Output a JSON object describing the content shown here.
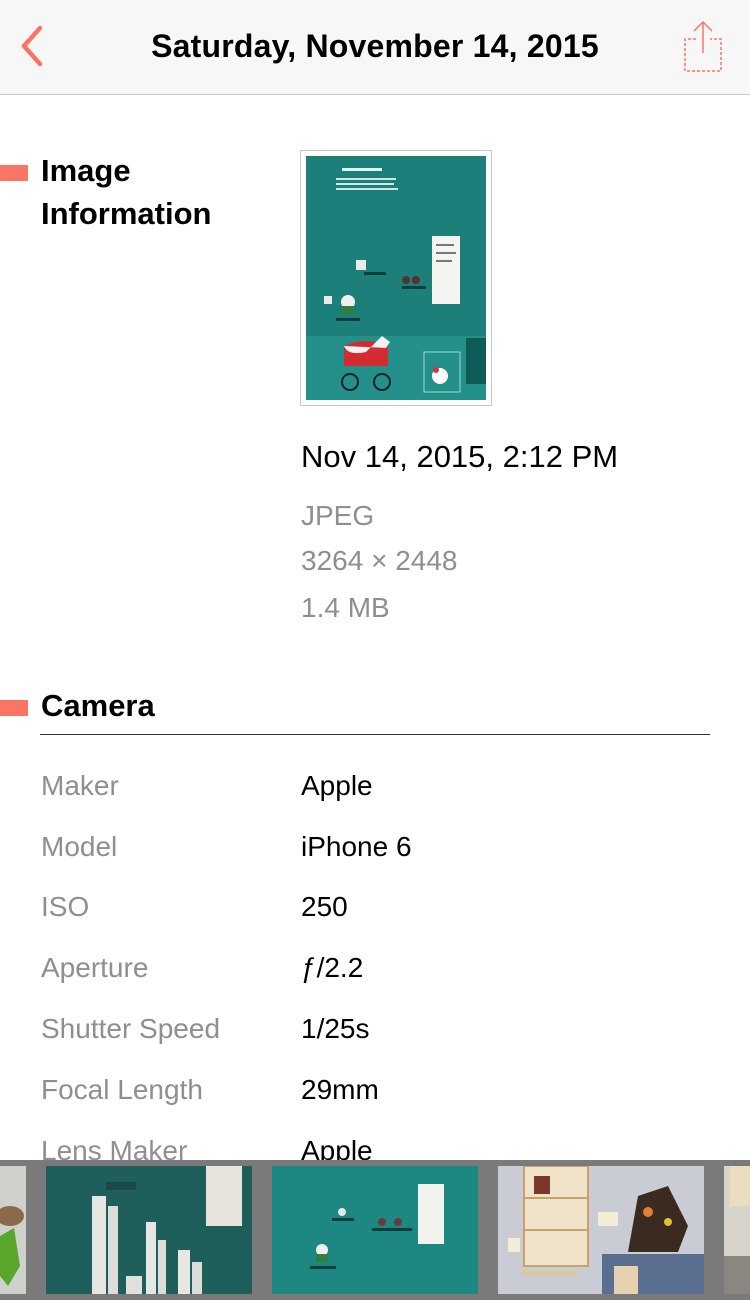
{
  "navbar": {
    "title": "Saturday, November 14, 2015",
    "back_icon": "chevron-left-icon",
    "share_icon": "share-icon",
    "accent_color": "#fa7566"
  },
  "image_info": {
    "section_title": "Image Information",
    "datetime": "Nov 14, 2015, 2:12 PM",
    "format": "JPEG",
    "dimensions": "3264 × 2448",
    "file_size": "1.4 MB"
  },
  "camera": {
    "section_title": "Camera",
    "rows": [
      {
        "label": "Maker",
        "value": "Apple"
      },
      {
        "label": "Model",
        "value": "iPhone 6"
      },
      {
        "label": "ISO",
        "value": "250"
      },
      {
        "label": "Aperture",
        "value": "ƒ/2.2"
      },
      {
        "label": "Shutter Speed",
        "value": "1/25s"
      },
      {
        "label": "Focal Length",
        "value": "29mm"
      },
      {
        "label": "Lens Maker",
        "value": "Apple"
      }
    ]
  },
  "filmstrip": {
    "background_color": "#7a7a7a",
    "thumbnails": [
      "exhibit-figure",
      "white-towers-exhibit",
      "teal-wall-exhibit",
      "shelf-display-exhibit",
      "partial-exhibit"
    ]
  }
}
